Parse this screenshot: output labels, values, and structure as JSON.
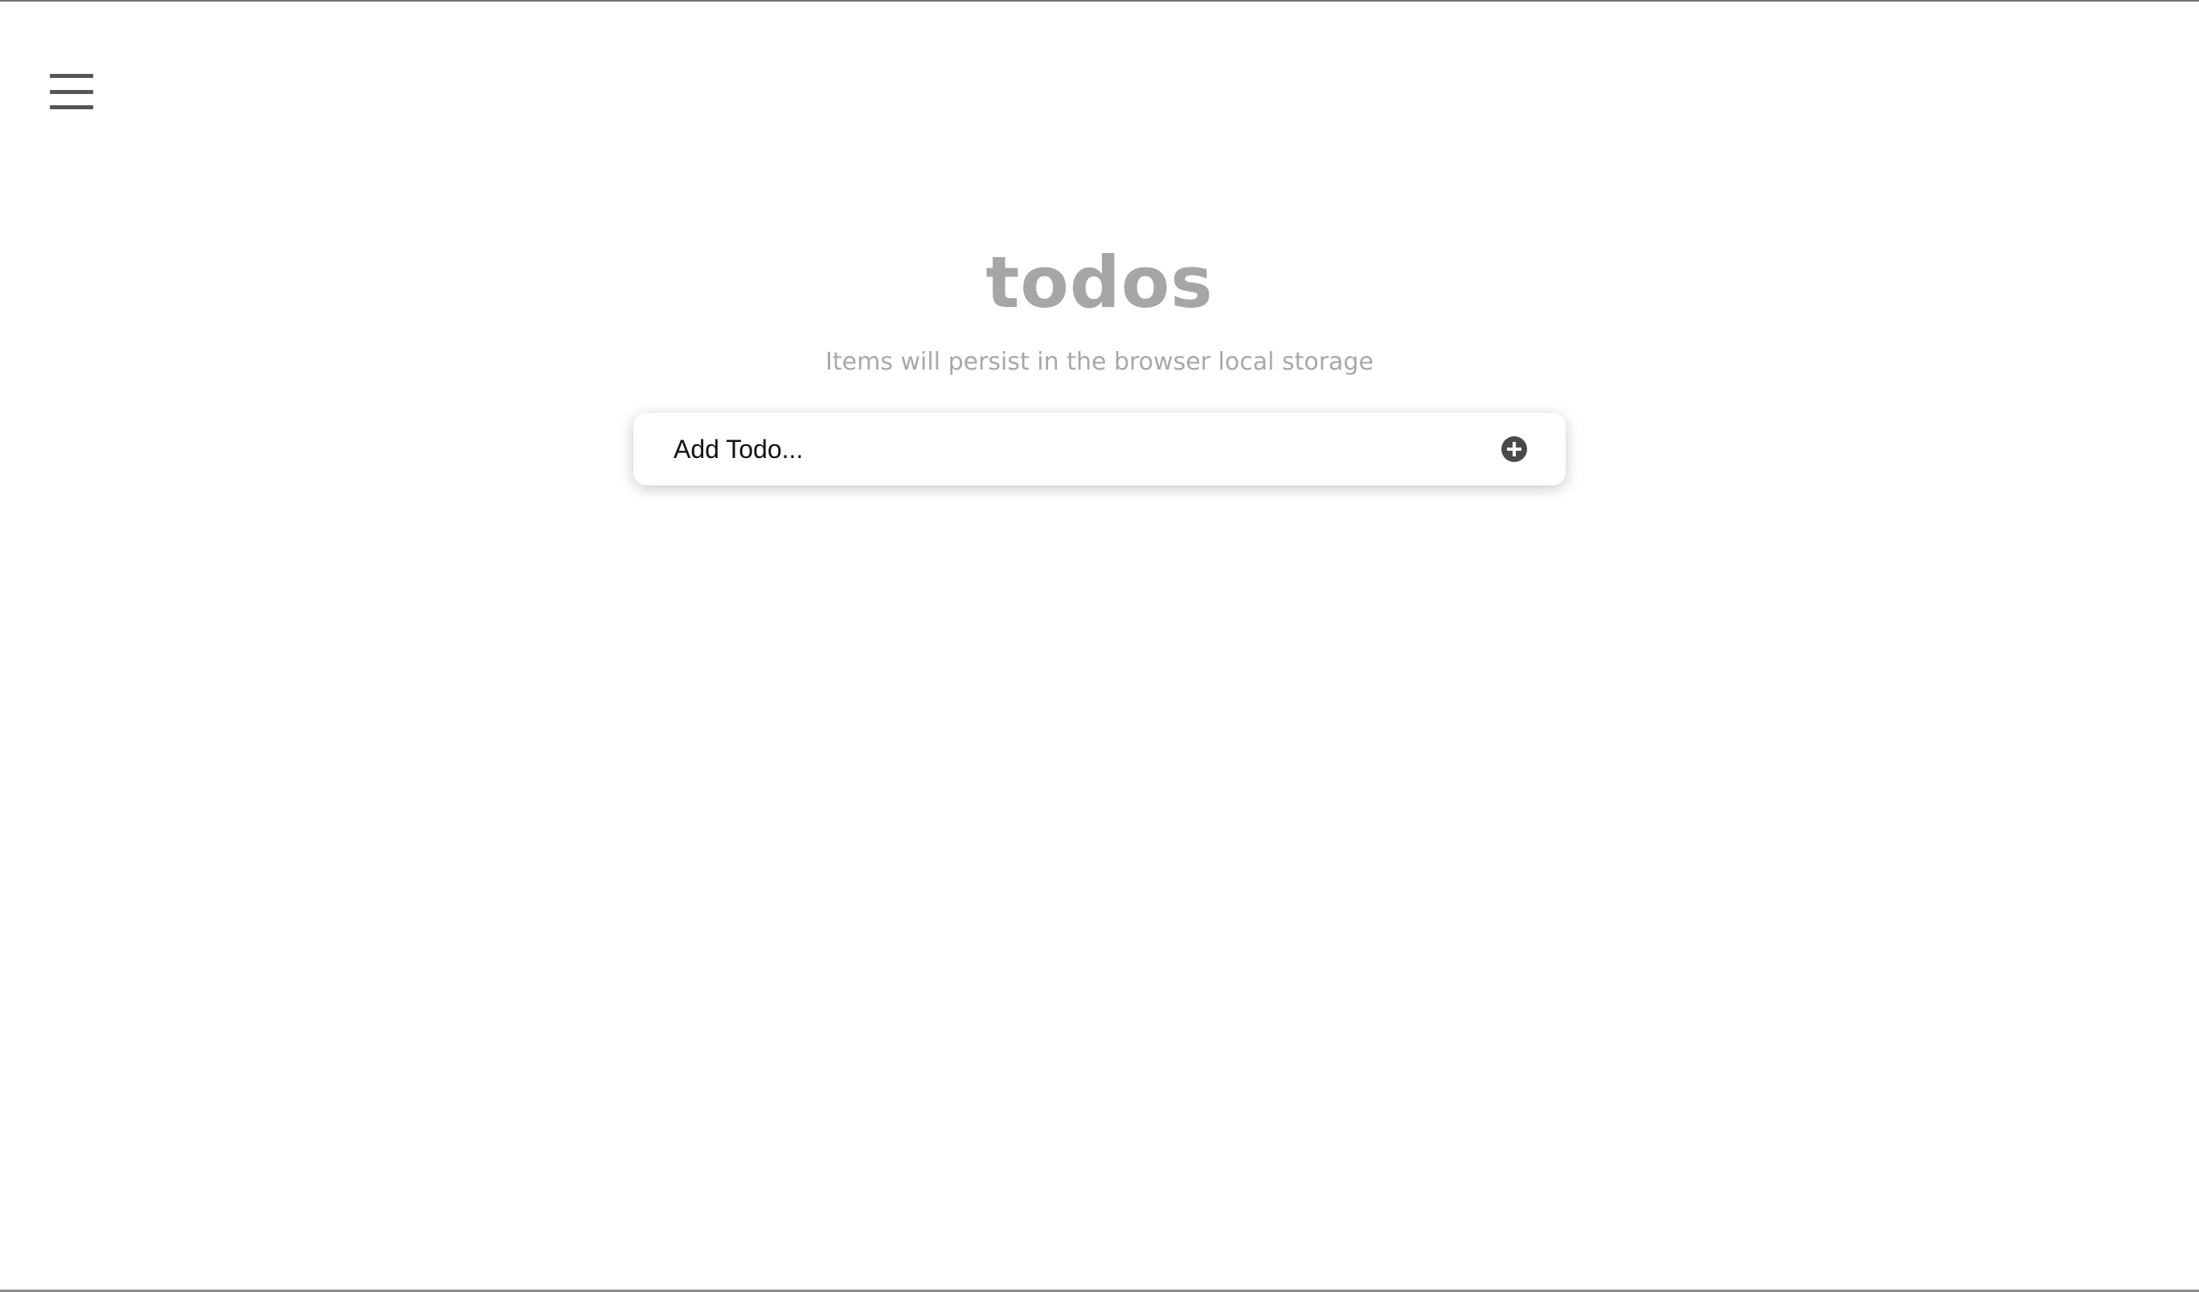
{
  "header": {
    "menu_icon": "hamburger-menu-icon"
  },
  "main": {
    "title": "todos",
    "subtitle": "Items will persist in the browser local storage"
  },
  "add_todo": {
    "placeholder": "Add Todo...",
    "value": "",
    "button_icon": "plus-circle-icon"
  },
  "colors": {
    "title": "#a6a6a6",
    "subtitle": "#a8a8a8",
    "icon": "#4a4a4a",
    "background": "#ffffff"
  }
}
